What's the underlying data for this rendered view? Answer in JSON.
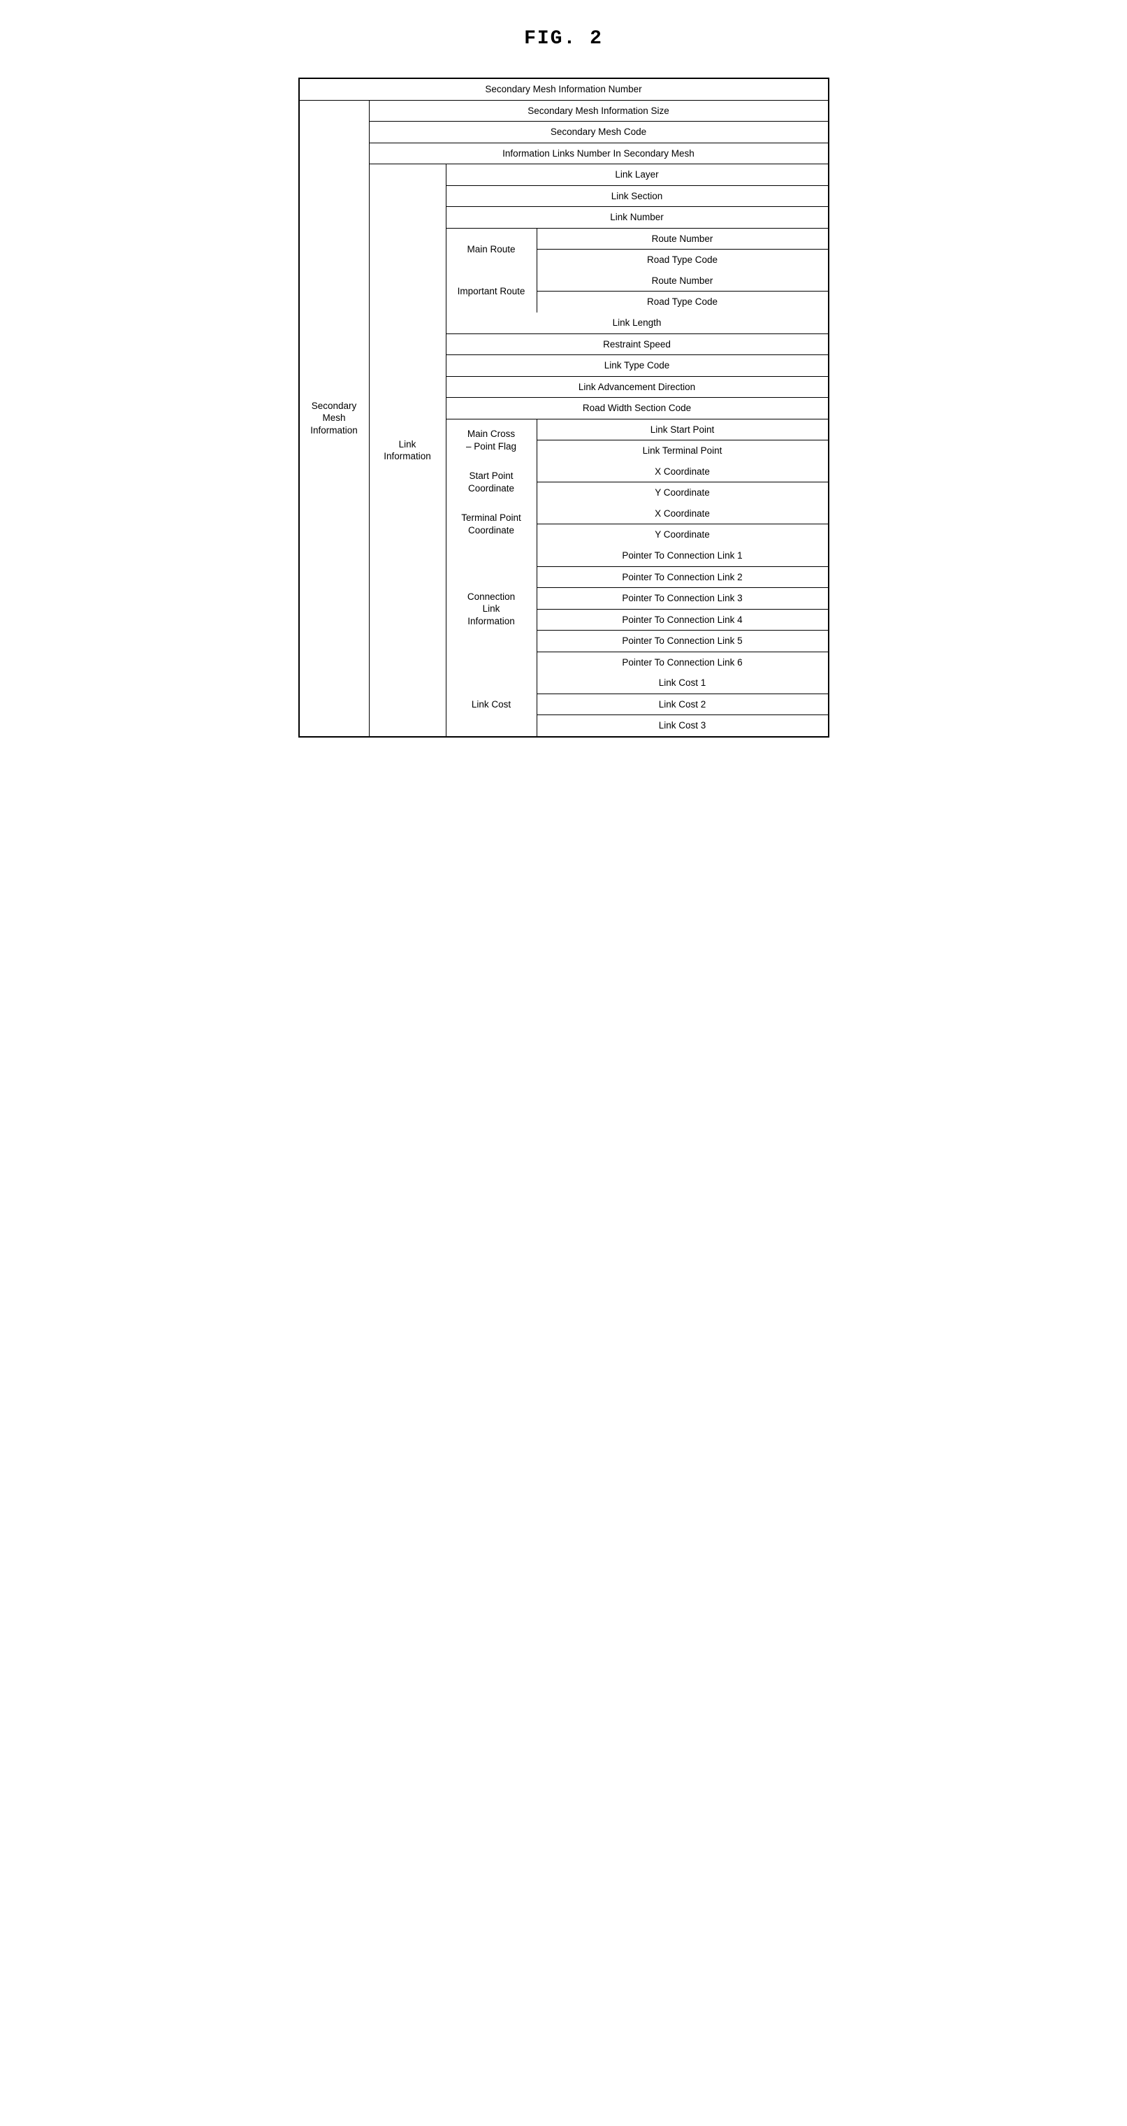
{
  "title": "FIG. 2",
  "table": {
    "rows": [
      {
        "type": "full",
        "text": "Secondary Mesh Information Number"
      },
      {
        "type": "c2c3c4",
        "c2": "Secondary Mesh Information Size"
      },
      {
        "type": "c2c3c4",
        "c2": "Secondary Mesh Code"
      },
      {
        "type": "c2c3c4",
        "c2": "Information Links Number In Secondary Mesh"
      },
      {
        "type": "c2_c3c4",
        "c3": "Link Layer"
      },
      {
        "type": "c2_c3c4",
        "c3": "Link Section"
      },
      {
        "type": "c2_c3c4",
        "c3": "Link Number"
      },
      {
        "type": "c2_sub_c4",
        "sub": "Main Route",
        "c4": "Route Number",
        "subRows": 2
      },
      {
        "type": "c2_sub_c4_cont",
        "sub": null,
        "c4": "Road Type Code"
      },
      {
        "type": "c2_sub_c4",
        "sub": "Important Route",
        "c4": "Route Number",
        "subRows": 2
      },
      {
        "type": "c2_sub_c4_cont",
        "sub": null,
        "c4": "Road Type Code"
      },
      {
        "type": "c2_c3c4",
        "c3": "Link Length"
      },
      {
        "type": "c2_c3c4",
        "c3": "Restraint Speed"
      },
      {
        "type": "c2_c3c4",
        "c3": "Link Type Code"
      },
      {
        "type": "c2_c3c4",
        "c3": "Link Advancement Direction"
      },
      {
        "type": "c2_c3c4",
        "c3": "Road Width Section Code"
      },
      {
        "type": "c2_sub_c4",
        "sub": "Main Cross\n– Point Flag",
        "c4": "Link Start Point",
        "subRows": 2
      },
      {
        "type": "c2_sub_c4_cont",
        "sub": null,
        "c4": "Link Terminal Point"
      },
      {
        "type": "c2_sub_c4",
        "sub": "Start Point\nCoordinate",
        "c4": "X Coordinate",
        "subRows": 2
      },
      {
        "type": "c2_sub_c4_cont",
        "sub": null,
        "c4": "Y Coordinate"
      },
      {
        "type": "c2_sub_c4",
        "sub": "Terminal Point\nCoordinate",
        "c4": "X Coordinate",
        "subRows": 2
      },
      {
        "type": "c2_sub_c4_cont",
        "sub": null,
        "c4": "Y Coordinate"
      },
      {
        "type": "c2_sub_c4",
        "sub": "Connection\nLink\nInformation",
        "c4": "Pointer To Connection Link 1",
        "subRows": 6
      },
      {
        "type": "c2_sub_c4_cont",
        "c4": "Pointer To Connection Link 2"
      },
      {
        "type": "c2_sub_c4_cont",
        "c4": "Pointer To Connection Link 3"
      },
      {
        "type": "c2_sub_c4_cont",
        "c4": "Pointer To Connection Link 4"
      },
      {
        "type": "c2_sub_c4_cont",
        "c4": "Pointer To Connection Link 5"
      },
      {
        "type": "c2_sub_c4_cont",
        "c4": "Pointer To Connection Link 6"
      },
      {
        "type": "c2_sub_c4",
        "sub": "Link Cost",
        "c4": "Link Cost 1",
        "subRows": 3
      },
      {
        "type": "c2_sub_c4_cont",
        "c4": "Link Cost 2"
      },
      {
        "type": "c2_sub_c4_cont",
        "c4": "Link Cost 3"
      }
    ],
    "col1_label": "Secondary\nMesh\nInformation",
    "col2_label": "Link\nInformation"
  }
}
